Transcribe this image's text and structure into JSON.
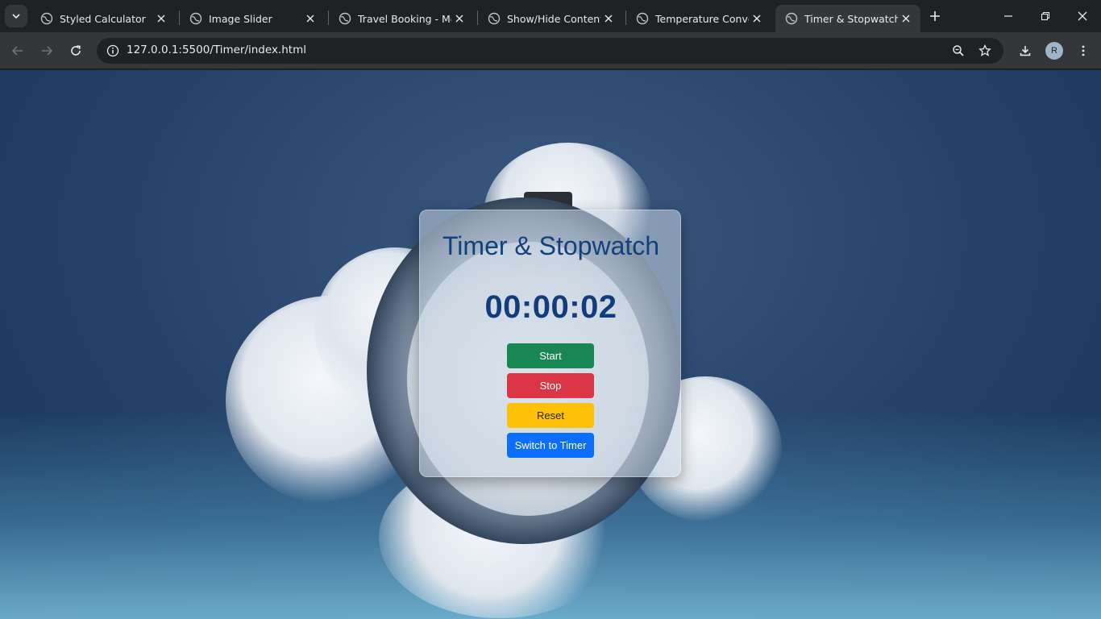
{
  "browser": {
    "tabs": [
      {
        "title": "Styled Calculator",
        "active": false
      },
      {
        "title": "Image Slider",
        "active": false
      },
      {
        "title": "Travel Booking - Mod",
        "active": false
      },
      {
        "title": "Show/Hide Content",
        "active": false
      },
      {
        "title": "Temperature Convert",
        "active": false
      },
      {
        "title": "Timer & Stopwatch",
        "active": true
      }
    ],
    "url": "127.0.0.1:5500/Timer/index.html",
    "profile_initial": "R"
  },
  "page": {
    "title": "Timer & Stopwatch",
    "display": "00:00:02",
    "buttons": {
      "start": "Start",
      "stop": "Stop",
      "reset": "Reset",
      "switch": "Switch to Timer"
    }
  },
  "colors": {
    "title": "#14407e",
    "start": "#198754",
    "stop": "#dc3545",
    "reset": "#ffc107",
    "switch": "#0d6efd"
  }
}
